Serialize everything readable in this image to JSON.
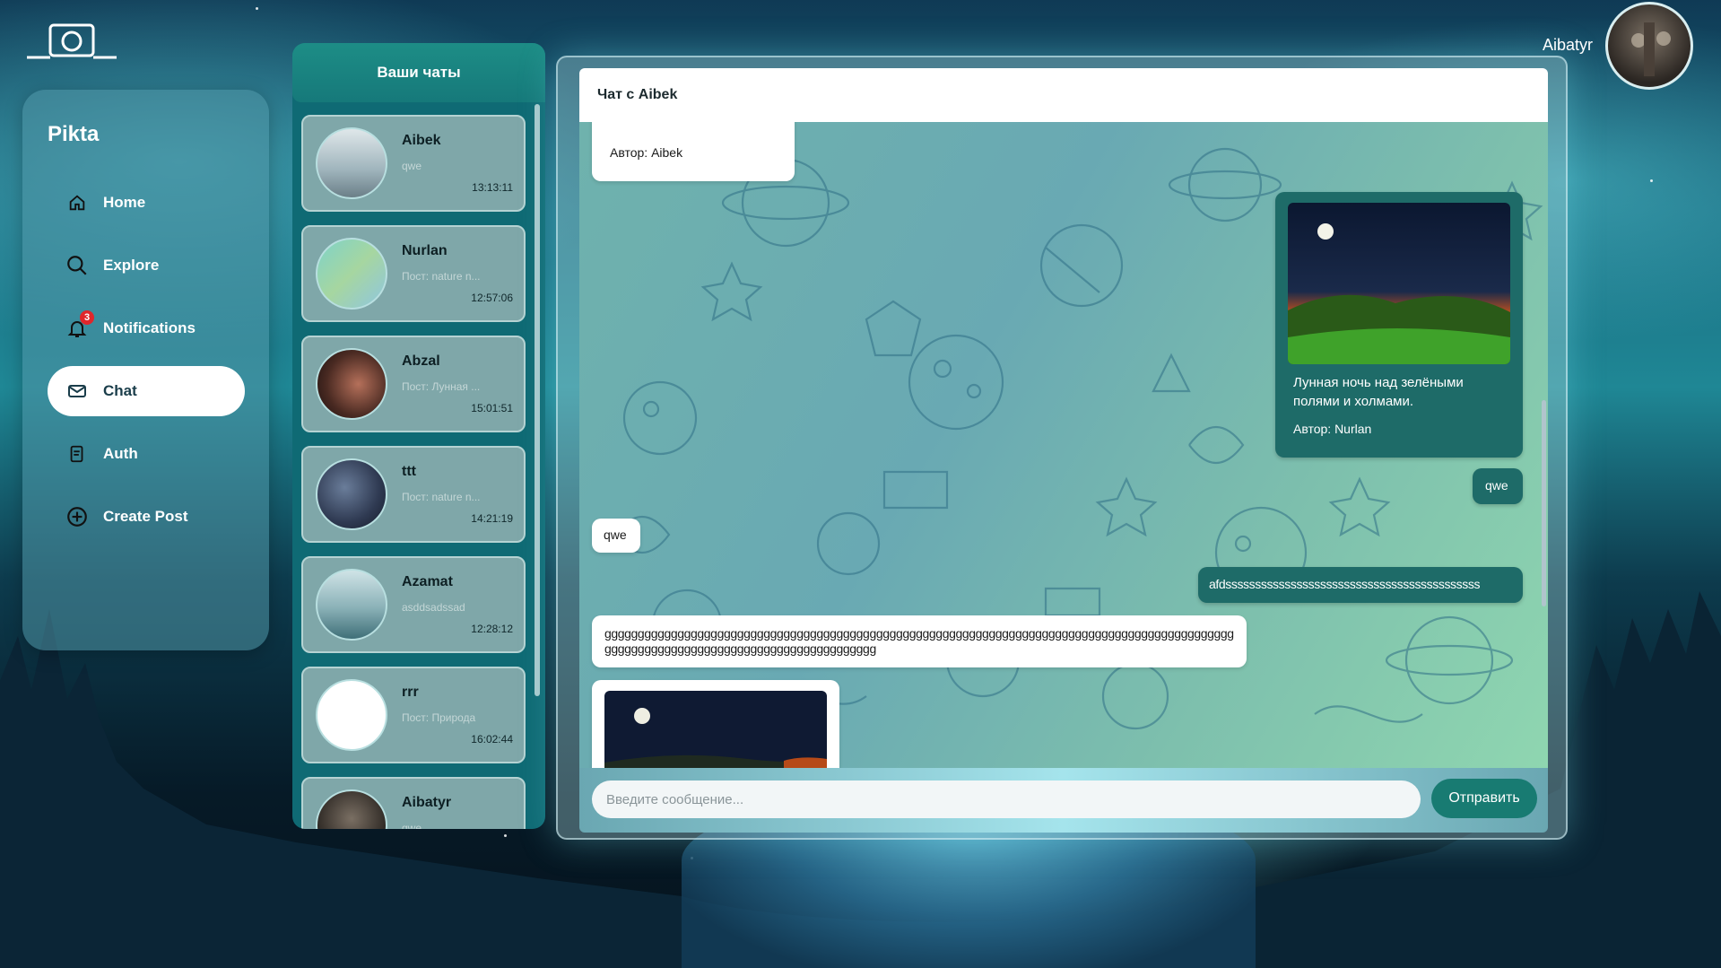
{
  "app": {
    "brand": "Pikta"
  },
  "user": {
    "name": "Aibatyr"
  },
  "nav": {
    "items": [
      {
        "label": "Home",
        "icon": "home-icon"
      },
      {
        "label": "Explore",
        "icon": "search-icon"
      },
      {
        "label": "Notifications",
        "icon": "bell-icon",
        "badge": "3"
      },
      {
        "label": "Chat",
        "icon": "mail-icon",
        "active": true
      },
      {
        "label": "Auth",
        "icon": "document-icon"
      },
      {
        "label": "Create Post",
        "icon": "plus-circle-icon"
      }
    ]
  },
  "chatlist": {
    "title": "Ваши чаты",
    "chats": [
      {
        "name": "Aibek",
        "preview": "qwe",
        "time": "13:13:11"
      },
      {
        "name": "Nurlan",
        "preview": "Пост: nature n...",
        "time": "12:57:06"
      },
      {
        "name": "Abzal",
        "preview": "Пост: Лунная ...",
        "time": "15:01:51"
      },
      {
        "name": "ttt",
        "preview": "Пост: nature n...",
        "time": "14:21:19"
      },
      {
        "name": "Azamat",
        "preview": "asddsadssad",
        "time": "12:28:12"
      },
      {
        "name": "rrr",
        "preview": "Пост: Природа",
        "time": "16:02:44"
      },
      {
        "name": "Aibatyr",
        "preview": "qwe",
        "time": ""
      }
    ]
  },
  "chat": {
    "title": "Чат с Aibek",
    "messages": {
      "top_post_author": "Автор: Aibek",
      "shared_post_caption": "Лунная ночь над зелёными полями и холмами.",
      "shared_post_author": "Автор: Nurlan",
      "out_qwe": "qwe",
      "in_qwe": "qwe",
      "out_long": "afdsssssssssssssssssssssssssssssssssssssssssss",
      "in_long": "gggggggggggggggggggggggggggggggggggggggggggggggggggggggggggggggggggggggggggggggggggggggggggggggggggggggggggggggggggggggggggggggggggggggg"
    },
    "input_placeholder": "Введите сообщение...",
    "send_label": "Отправить"
  }
}
